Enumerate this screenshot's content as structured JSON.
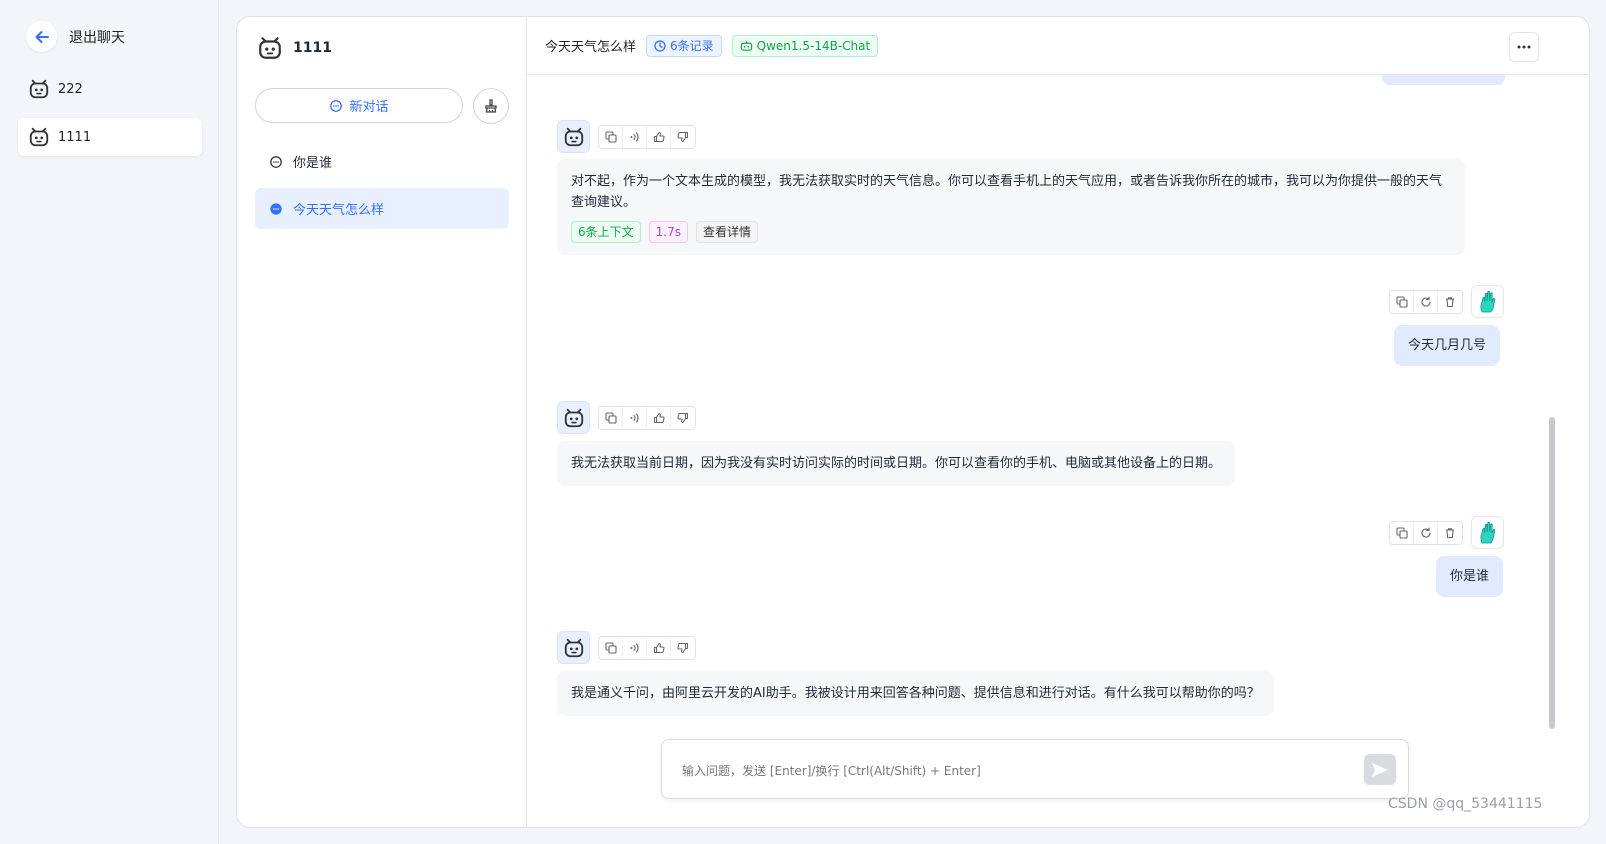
{
  "left_nav": {
    "back_label": "退出聊天",
    "apps": [
      {
        "name": "222",
        "active": false
      },
      {
        "name": "1111",
        "active": true
      }
    ]
  },
  "history": {
    "app_name": "1111",
    "new_chat_label": "新对话",
    "items": [
      {
        "label": "你是谁",
        "active": false
      },
      {
        "label": "今天天气怎么样",
        "active": true
      }
    ]
  },
  "chat_header": {
    "title": "今天天气怎么样",
    "records_tag": "6条记录",
    "model_tag": "Qwen1.5-14B-Chat"
  },
  "messages": [
    {
      "role": "ai",
      "text": "对不起，作为一个文本生成的模型，我无法获取实时的天气信息。你可以查看手机上的天气应用，或者告诉我你所在的城市，我可以为你提供一般的天气查询建议。",
      "context_tag": "6条上下文",
      "time_tag": "1.7s",
      "detail_label": "查看详情"
    },
    {
      "role": "user",
      "text": "今天几月几号"
    },
    {
      "role": "ai",
      "text": "我无法获取当前日期，因为我没有实时访问实际的时间或日期。你可以查看你的手机、电脑或其他设备上的日期。"
    },
    {
      "role": "user",
      "text": "你是谁"
    },
    {
      "role": "ai",
      "text": "我是通义千问，由阿里云开发的AI助手。我被设计用来回答各种问题、提供信息和进行对话。有什么我可以帮助你的吗？"
    }
  ],
  "input": {
    "placeholder": "输入问题，发送 [Enter]/换行 [Ctrl(Alt/Shift) + Enter]"
  },
  "watermark": "CSDN @qq_53441115",
  "colors": {
    "accent": "#3370ff",
    "success": "#16a34a",
    "user_bubble": "#e1eaff",
    "ai_bubble": "#f6f7f9"
  }
}
